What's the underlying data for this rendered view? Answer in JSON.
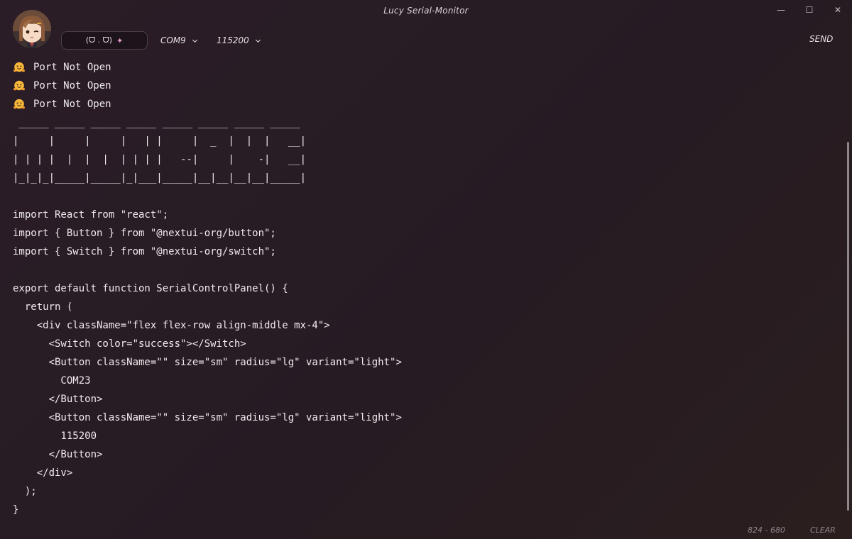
{
  "window": {
    "title": "Lucy Serial-Monitor",
    "controls": {
      "minimize": "—",
      "maximize": "☐",
      "close": "✕"
    }
  },
  "toolbar": {
    "avatar_icon": "anime-avatar",
    "toggle_text": "(ᗜ . ᗜ)",
    "toggle_icon": "party-popper-icon",
    "port": {
      "value": "COM9",
      "icon": "chevron-down-icon"
    },
    "baud": {
      "value": "115200",
      "icon": "chevron-down-icon"
    },
    "send_label": "SEND"
  },
  "terminal": {
    "status_icon": "hugging-face-icon",
    "status_lines": [
      "Port Not Open",
      "Port Not Open",
      "Port Not Open"
    ],
    "lines": [
      " _____ _____ _____ _____ _____ _____ _____ _____",
      "|     |     |     |   | |     |  _  |  |  |   __|",
      "| | | |  |  |  |  | | | |   --|     |    -|   __|",
      "|_|_|_|_____|_____|_|___|_____|__|__|__|__|_____|",
      "",
      "import React from \"react\";",
      "import { Button } from \"@nextui-org/button\";",
      "import { Switch } from \"@nextui-org/switch\";",
      "",
      "export default function SerialControlPanel() {",
      "  return (",
      "    <div className=\"flex flex-row align-middle mx-4\">",
      "      <Switch color=\"success\"></Switch>",
      "      <Button className=\"\" size=\"sm\" radius=\"lg\" variant=\"light\">",
      "        COM23",
      "      </Button>",
      "      <Button className=\"\" size=\"sm\" radius=\"lg\" variant=\"light\">",
      "        115200",
      "      </Button>",
      "    </div>",
      "  );",
      "}"
    ]
  },
  "footer": {
    "dimensions": "824 - 680",
    "clear_label": "CLEAR"
  },
  "colors": {
    "background": "#271c24",
    "text": "#f0eaee",
    "muted": "#8d858b",
    "accent_emoji": "#f6b93b"
  }
}
